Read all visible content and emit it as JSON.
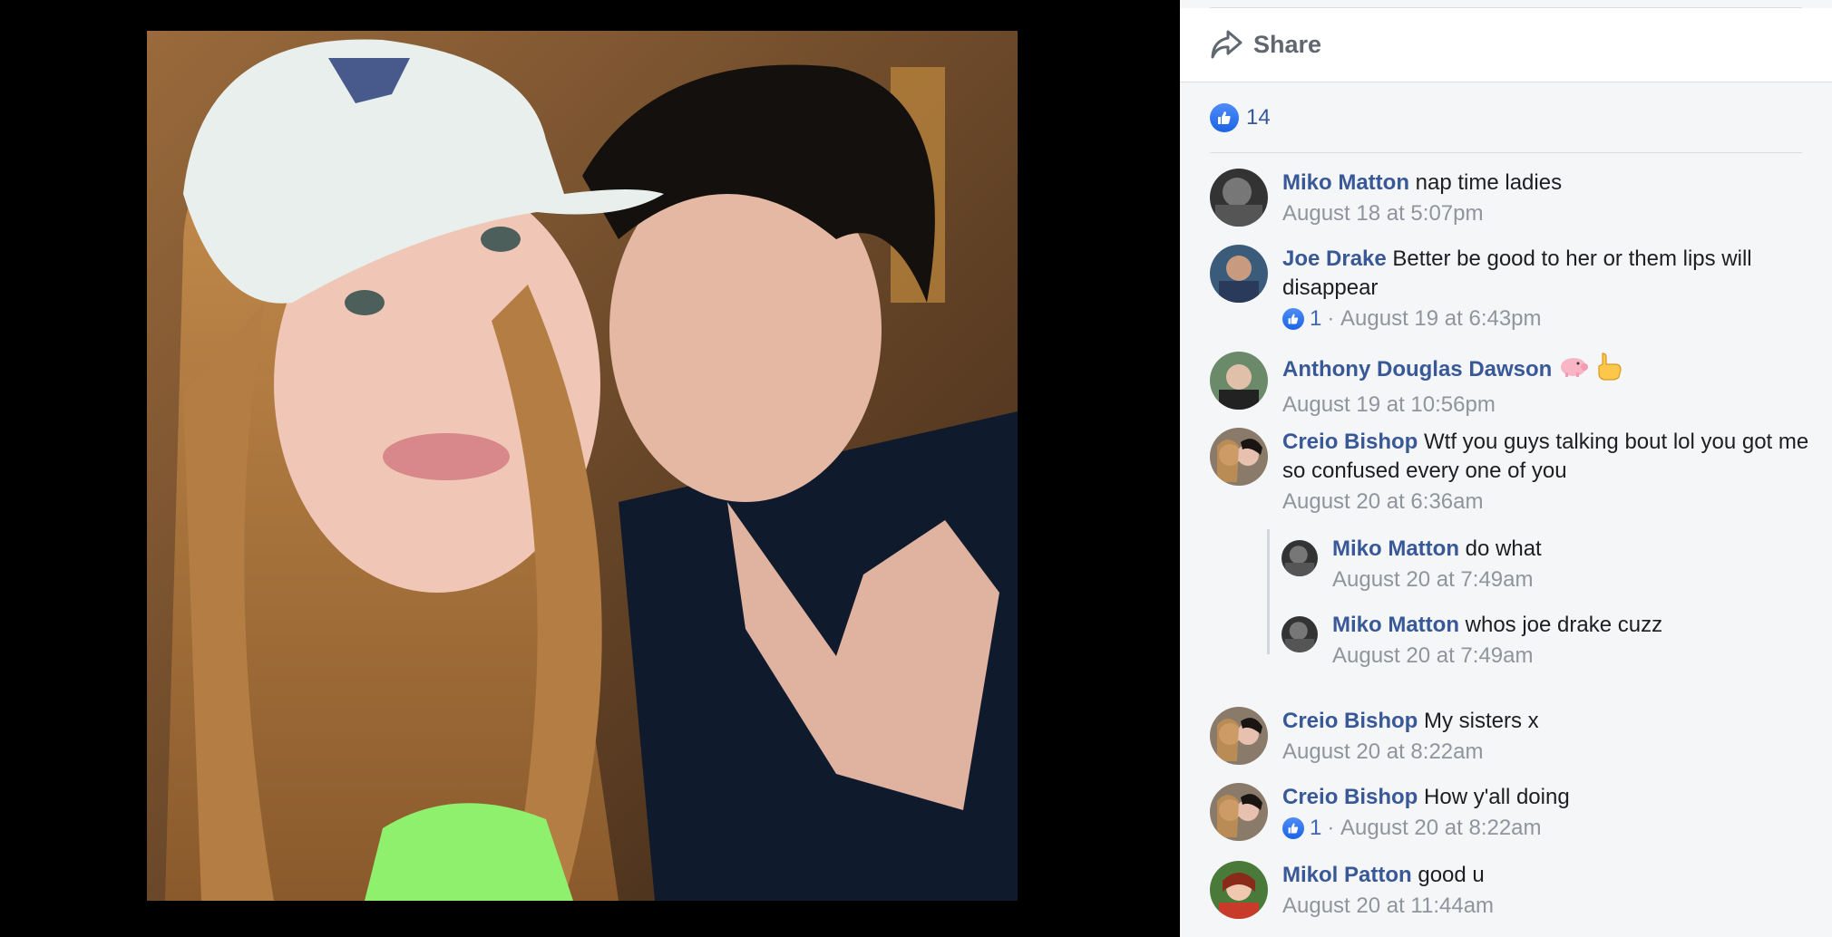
{
  "actions": {
    "share_label": "Share"
  },
  "reactions": {
    "count": "14"
  },
  "comments": [
    {
      "author": "Miko Matton",
      "text": "nap time ladies",
      "time": "August 18 at 5:07pm"
    },
    {
      "author": "Joe Drake",
      "text": "Better be good to her or them lips will disappear",
      "likes": "1",
      "time": "August 19 at 6:43pm"
    },
    {
      "author": "Anthony Douglas Dawson",
      "text": "",
      "emoji": [
        "pig-emoji",
        "pointing-hand-emoji"
      ],
      "time": "August 19 at 10:56pm"
    },
    {
      "author": "Creio Bishop",
      "text": "Wtf you guys talking bout lol you got me so confused every one of you",
      "time": "August 20 at 6:36am"
    },
    {
      "author": "Miko Matton",
      "text": "do what",
      "time": "August 20 at 7:49am"
    },
    {
      "author": "Miko Matton",
      "text": "whos joe drake cuzz",
      "time": "August 20 at 7:49am"
    },
    {
      "author": "Creio Bishop",
      "text": "My sisters x",
      "time": "August 20 at 8:22am"
    },
    {
      "author": "Creio Bishop",
      "text": "How y'all doing",
      "likes": "1",
      "time": "August 20 at 8:22am"
    },
    {
      "author": "Mikol Patton",
      "text": "good u",
      "time": "August 20 at 11:44am"
    }
  ],
  "colors": {
    "link": "#385898",
    "meta": "#90949c",
    "like": "#4f8cf7",
    "panel_bg": "#f5f6f7"
  }
}
